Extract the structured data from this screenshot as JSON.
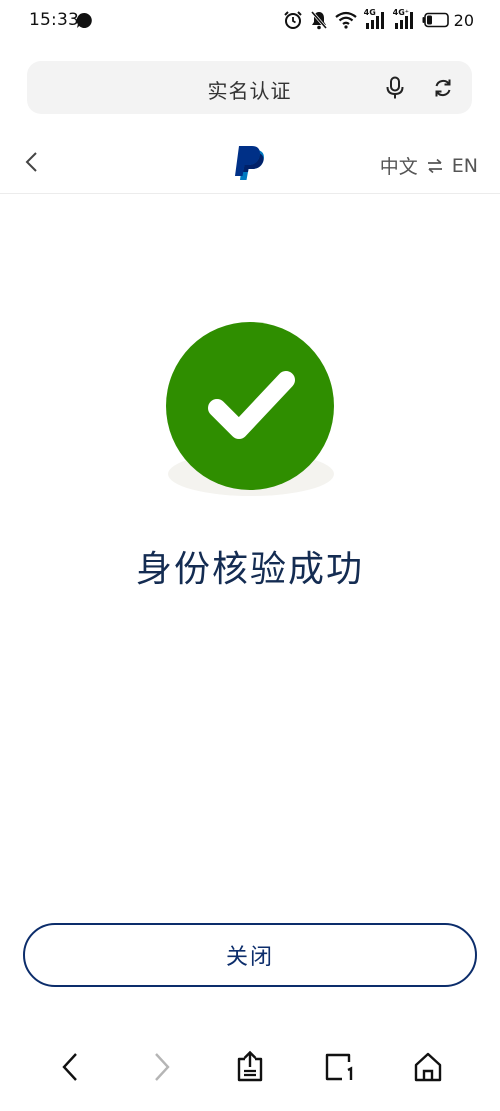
{
  "status_bar": {
    "time": "15:33",
    "net_left": "4G",
    "net_right": "4G⁺",
    "battery": "20"
  },
  "browser": {
    "title": "实名认证"
  },
  "header": {
    "lang_current": "中文",
    "lang_other": "EN"
  },
  "main": {
    "success_text": "身份核验成功",
    "close_label": "关闭"
  },
  "colors": {
    "success": "#2f8e00",
    "brand_navy": "#0c2d6b",
    "title_navy": "#142c52"
  },
  "icons": {
    "back": "chevron-left-icon",
    "forward": "chevron-right-icon",
    "share": "share-icon",
    "tabs": "tabs-icon",
    "home": "home-icon"
  }
}
